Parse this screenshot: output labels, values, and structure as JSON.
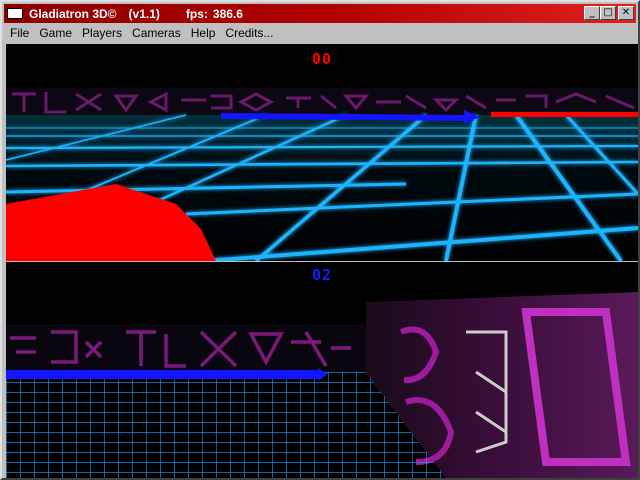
{
  "window": {
    "title": "Gladiatron 3D©",
    "version": "(v1.1)",
    "fps_label": "fps:",
    "fps_value": "386.6",
    "buttons": {
      "minimize": "_",
      "maximize": "□",
      "close": "✕"
    }
  },
  "menu": [
    "File",
    "Game",
    "Players",
    "Cameras",
    "Help",
    "Credits..."
  ],
  "players": [
    {
      "score": "00",
      "color": "#ff0000"
    },
    {
      "score": "02",
      "color": "#1a1aff"
    }
  ],
  "colors": {
    "grid": "#22aaff",
    "wall": "#8a1a8a",
    "trail_red": "#ff0000",
    "trail_blue": "#1414ff"
  }
}
